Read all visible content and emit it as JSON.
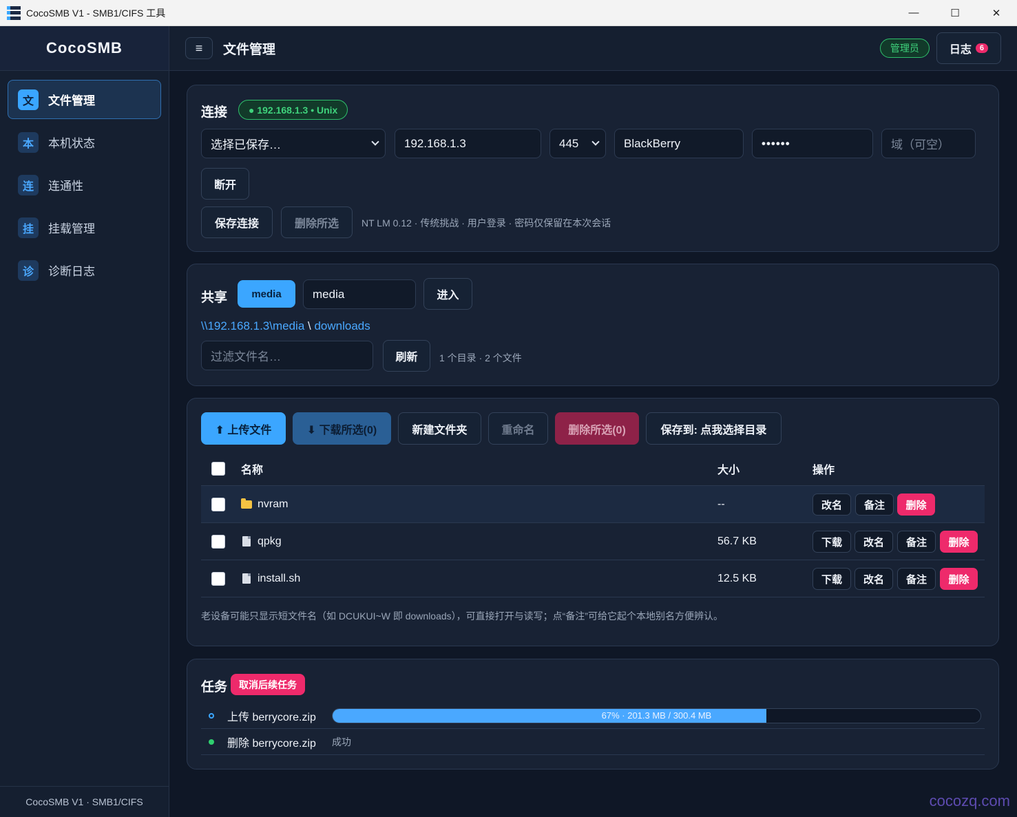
{
  "window": {
    "title": "CocoSMB V1 - SMB1/CIFS 工具"
  },
  "sidebar": {
    "brand": "CocoSMB",
    "items": [
      {
        "badge": "文",
        "label": "文件管理"
      },
      {
        "badge": "本",
        "label": "本机状态"
      },
      {
        "badge": "连",
        "label": "连通性"
      },
      {
        "badge": "挂",
        "label": "挂载管理"
      },
      {
        "badge": "诊",
        "label": "诊断日志"
      }
    ],
    "footer": "CocoSMB V1 · SMB1/CIFS"
  },
  "header": {
    "menu_icon": "≡",
    "title": "文件管理",
    "role_badge": "管理员",
    "log_label": "日志",
    "log_count": "6"
  },
  "connect": {
    "title": "连接",
    "status": "● 192.168.1.3 • Unix",
    "saved_select": "选择已保存…",
    "host": "192.168.1.3",
    "port": "445",
    "username": "BlackBerry",
    "password": "••••••",
    "domain_placeholder": "域（可空）",
    "disconnect": "断开",
    "save": "保存连接",
    "delete_selected": "删除所选",
    "info": "NT LM 0.12 · 传统挑战 · 用户登录 · 密码仅保留在本次会话"
  },
  "share": {
    "title": "共享",
    "active_share": "media",
    "share_input": "media",
    "enter": "进入",
    "path_root": "\\\\192.168.1.3\\media",
    "path_sep": " \\ ",
    "path_leaf": "downloads",
    "filter_placeholder": "过滤文件名…",
    "refresh": "刷新",
    "summary": "1 个目录 · 2 个文件"
  },
  "files": {
    "toolbar": {
      "upload": "⬆ 上传文件",
      "download": "⬇ 下载所选(0)",
      "new_folder": "新建文件夹",
      "rename": "重命名",
      "delete": "删除所选(0)",
      "save_to": "保存到: 点我选择目录"
    },
    "columns": {
      "name": "名称",
      "size": "大小",
      "ops": "操作"
    },
    "rows": [
      {
        "name": "nvram",
        "size": "--",
        "type": "folder"
      },
      {
        "name": "qpkg",
        "size": "56.7 KB",
        "type": "file"
      },
      {
        "name": "install.sh",
        "size": "12.5 KB",
        "type": "file"
      }
    ],
    "ops": {
      "download": "下载",
      "rename": "改名",
      "note": "备注",
      "delete": "删除"
    },
    "footnote": "老设备可能只显示短文件名（如 DCUKUI~W 即 downloads），可直接打开与读写；点“备注”可给它起个本地别名方便辨认。"
  },
  "tasks": {
    "title": "任务",
    "cancel": "取消后续任务",
    "items": [
      {
        "name": "上传 berrycore.zip",
        "progress": 0.67,
        "label": "67% · 201.3 MB / 300.4 MB"
      },
      {
        "name": "删除 berrycore.zip",
        "status": "成功"
      }
    ]
  },
  "watermark": "cocozq.com",
  "colors": {
    "accent": "#3ba6ff",
    "danger": "#ee2a6b",
    "success": "#2fcf6f",
    "background": "#0f1726"
  }
}
